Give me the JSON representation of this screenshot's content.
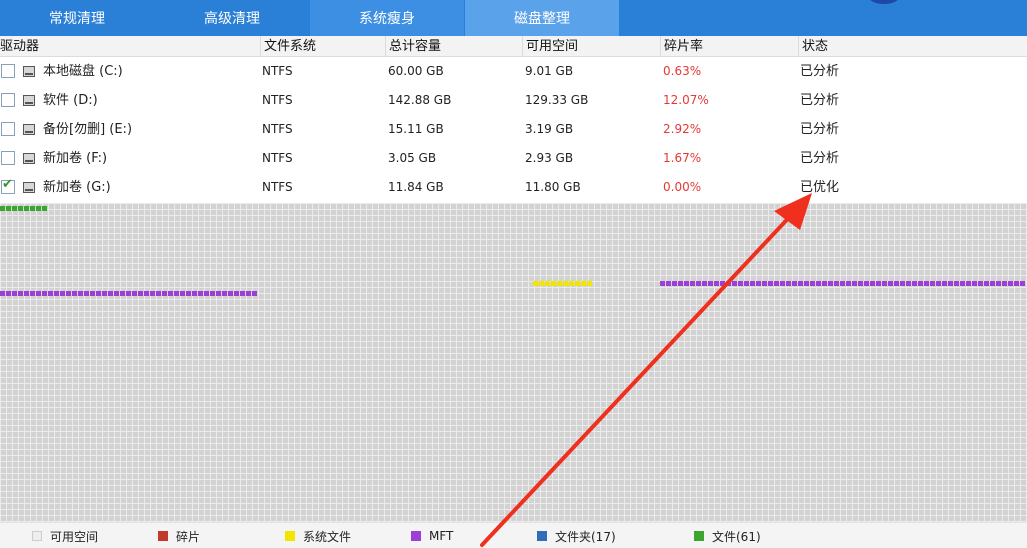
{
  "tabs": [
    {
      "label": "常规清理"
    },
    {
      "label": "高级清理"
    },
    {
      "label": "系统瘦身"
    },
    {
      "label": "磁盘整理"
    }
  ],
  "table": {
    "headers": [
      "驱动器",
      "文件系统",
      "总计容量",
      "可用空间",
      "碎片率",
      "状态"
    ],
    "rows": [
      {
        "name": "本地磁盘 (C:)",
        "fs": "NTFS",
        "total": "60.00 GB",
        "free": "9.01 GB",
        "frag": "0.63%",
        "status": "已分析",
        "checked": false
      },
      {
        "name": "软件 (D:)",
        "fs": "NTFS",
        "total": "142.88 GB",
        "free": "129.33 GB",
        "frag": "12.07%",
        "status": "已分析",
        "checked": false
      },
      {
        "name": "备份[勿删] (E:)",
        "fs": "NTFS",
        "total": "15.11 GB",
        "free": "3.19 GB",
        "frag": "2.92%",
        "status": "已分析",
        "checked": false
      },
      {
        "name": "新加卷 (F:)",
        "fs": "NTFS",
        "total": "3.05 GB",
        "free": "2.93 GB",
        "frag": "1.67%",
        "status": "已分析",
        "checked": false
      },
      {
        "name": "新加卷 (G:)",
        "fs": "NTFS",
        "total": "11.84 GB",
        "free": "11.80 GB",
        "frag": "0.00%",
        "status": "已优化",
        "checked": true
      }
    ]
  },
  "legend": [
    {
      "label": "可用空间",
      "color": "#eeeeee"
    },
    {
      "label": "碎片",
      "color": "#c0392b"
    },
    {
      "label": "系统文件",
      "color": "#f2e600"
    },
    {
      "label": "MFT",
      "color": "#9b3fd6"
    },
    {
      "label": "文件夹(17)",
      "color": "#2f6db8"
    },
    {
      "label": "文件(61)",
      "color": "#3aa62f"
    }
  ],
  "colors": {
    "accent": "#2a7fd6",
    "fragment_text": "#e53935",
    "annotation_arrow": "#f0301e"
  }
}
